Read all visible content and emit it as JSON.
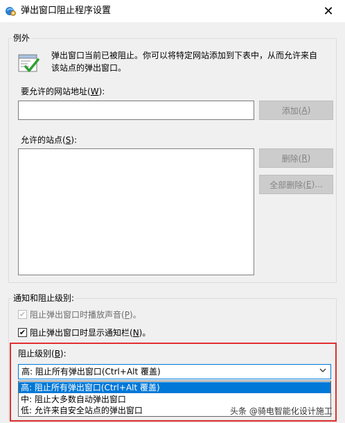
{
  "window": {
    "title": "弹出窗口阻止程序设置",
    "close_glyph": "✕"
  },
  "exceptions": {
    "legend": "例外",
    "description_line1": "弹出窗口当前已被阻止。你可以将特定网站添加到下表中，从而允许来自",
    "description_line2": "该站点的弹出窗口。",
    "address_label_prefix": "要允许的网站地址(",
    "address_label_key": "W",
    "address_label_suffix": "):",
    "address_value": "",
    "add_button_prefix": "添加(",
    "add_button_key": "A",
    "add_button_suffix": ")",
    "sites_label_prefix": "允许的站点(",
    "sites_label_key": "S",
    "sites_label_suffix": "):",
    "remove_button_prefix": "删除(",
    "remove_button_key": "R",
    "remove_button_suffix": ")",
    "remove_all_button_prefix": "全部删除(",
    "remove_all_button_key": "E",
    "remove_all_button_suffix": ")..."
  },
  "notifications": {
    "legend": "通知和阻止级别:",
    "sound_label_prefix": "阻止弹出窗口时播放声音(",
    "sound_label_key": "P",
    "sound_label_suffix": ")。",
    "sound_checked": true,
    "bar_label_prefix": "阻止弹出窗口时显示通知栏(",
    "bar_label_key": "N",
    "bar_label_suffix": ")。",
    "bar_checked": true,
    "level_label_prefix": "阻止级别(",
    "level_label_key": "B",
    "level_label_suffix": "):",
    "level_selected": "高: 阻止所有弹出窗口(Ctrl+Alt 覆盖)",
    "level_options": [
      "高: 阻止所有弹出窗口(Ctrl+Alt 覆盖)",
      "中: 阻止大多数自动弹出窗口",
      "低: 允许来自安全站点的弹出窗口"
    ]
  },
  "watermark": "头条 @骑电智能化设计施工",
  "colors": {
    "accent": "#0078d7",
    "highlight": "#e03030"
  }
}
